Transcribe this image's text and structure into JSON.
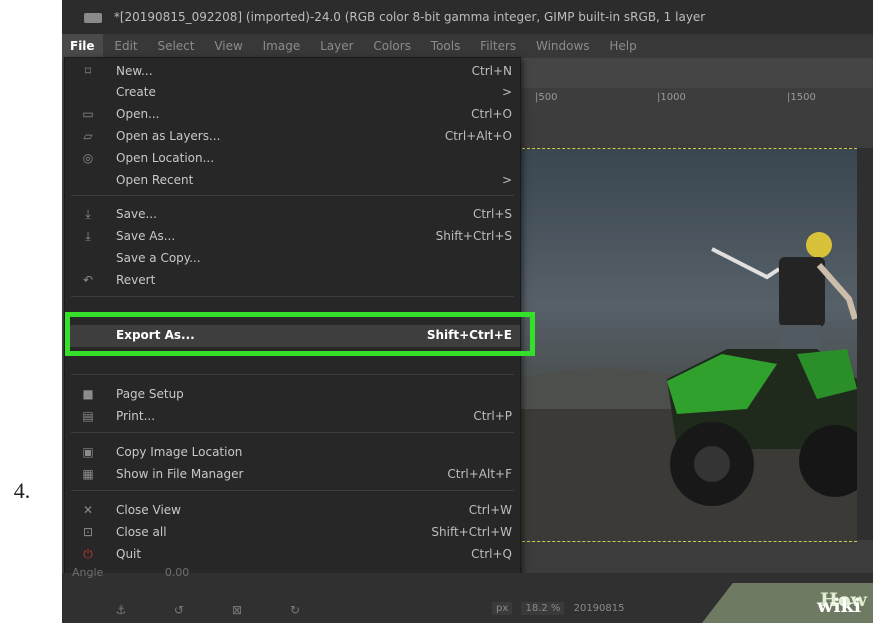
{
  "step_number": "4.",
  "window": {
    "title": "*[20190815_092208] (imported)-24.0 (RGB color 8-bit gamma integer, GIMP built-in sRGB, 1 layer",
    "menubar": [
      "File",
      "Edit",
      "Select",
      "View",
      "Image",
      "Layer",
      "Colors",
      "Tools",
      "Filters",
      "Windows",
      "Help"
    ],
    "active_menu": "File",
    "ruler_ticks": [
      "|500",
      "|1000",
      "|1500"
    ]
  },
  "file_menu": {
    "items": [
      {
        "icon": "new-icon",
        "label": "New...",
        "shortcut": "Ctrl+N"
      },
      {
        "icon": "",
        "label": "Create",
        "shortcut": ">"
      },
      {
        "icon": "open-icon",
        "label": "Open...",
        "shortcut": "Ctrl+O"
      },
      {
        "icon": "open-layers-icon",
        "label": "Open as Layers...",
        "shortcut": "Ctrl+Alt+O"
      },
      {
        "icon": "globe-icon",
        "label": "Open Location...",
        "shortcut": ""
      },
      {
        "icon": "",
        "label": "Open Recent",
        "shortcut": ">"
      },
      {
        "icon": "save-icon",
        "label": "Save...",
        "shortcut": "Ctrl+S"
      },
      {
        "icon": "save-as-icon",
        "label": "Save As...",
        "shortcut": "Shift+Ctrl+S"
      },
      {
        "icon": "",
        "label": "Save a Copy...",
        "shortcut": ""
      },
      {
        "icon": "revert-icon",
        "label": "Revert",
        "shortcut": ""
      },
      {
        "icon": "",
        "label": "Export As...",
        "shortcut": "Shift+Ctrl+E"
      },
      {
        "icon": "page-setup-icon",
        "label": "Page Setup",
        "shortcut": ""
      },
      {
        "icon": "print-icon",
        "label": "Print...",
        "shortcut": "Ctrl+P"
      },
      {
        "icon": "copy-location-icon",
        "label": "Copy Image Location",
        "shortcut": ""
      },
      {
        "icon": "file-manager-icon",
        "label": "Show in File Manager",
        "shortcut": "Ctrl+Alt+F"
      },
      {
        "icon": "close-icon",
        "label": "Close View",
        "shortcut": "Ctrl+W"
      },
      {
        "icon": "close-all-icon",
        "label": "Close all",
        "shortcut": "Shift+Ctrl+W"
      },
      {
        "icon": "quit-icon",
        "label": "Quit",
        "shortcut": "Ctrl+Q"
      }
    ],
    "highlighted": "Export As..."
  },
  "tool_options": {
    "angle_label": "Angle",
    "angle_value": "0.00"
  },
  "status": {
    "unit": "px",
    "zoom": "18.2 %",
    "filename": "20190815"
  },
  "watermark": {
    "wiki": "wiki",
    "how": "How"
  },
  "colors": {
    "highlight_border": "#35e02b",
    "menu_bg": "#272727"
  }
}
